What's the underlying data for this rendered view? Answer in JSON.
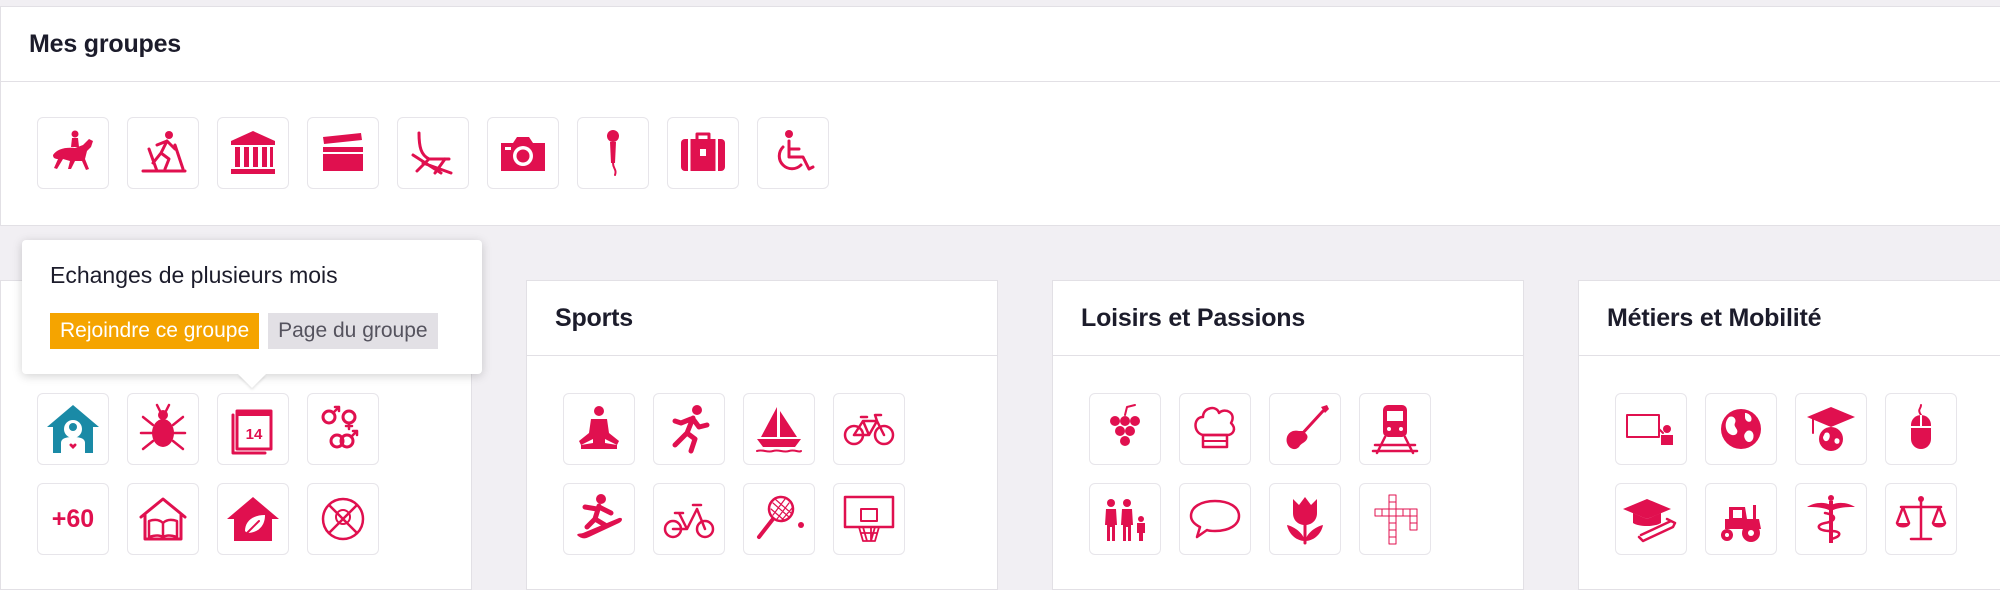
{
  "mes_groupes": {
    "title": "Mes groupes",
    "icons": [
      "horse-rider-icon",
      "cross-country-ski-icon",
      "museum-icon",
      "clapperboard-icon",
      "lounge-chair-icon",
      "camera-icon",
      "microphone-icon",
      "suitcase-icon",
      "wheelchair-icon"
    ]
  },
  "tooltip": {
    "title": "Echanges de plusieurs mois",
    "join_label": "Rejoindre ce groupe",
    "page_label": "Page du groupe"
  },
  "left_panel": {
    "plus60_label": "+60"
  },
  "sports": {
    "title": "Sports"
  },
  "loisirs": {
    "title": "Loisirs et Passions"
  },
  "metiers": {
    "title": "Métiers et Mobilité"
  },
  "colors": {
    "accent": "#e0104f",
    "teal": "#1a8aa6",
    "join": "#f5a400"
  }
}
